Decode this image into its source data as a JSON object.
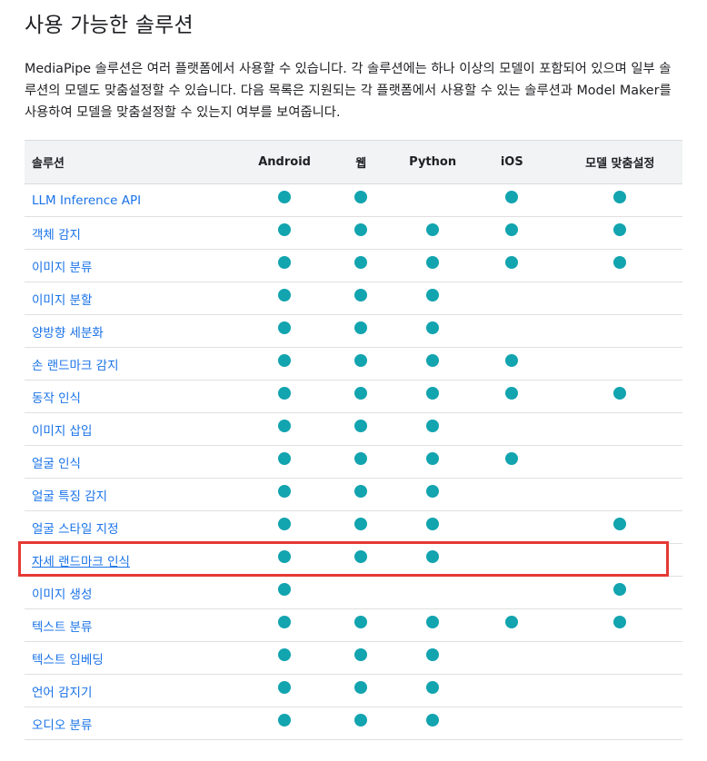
{
  "page": {
    "title": "사용 가능한 솔루션",
    "intro": "MediaPipe 솔루션은 여러 플랫폼에서 사용할 수 있습니다. 각 솔루션에는 하나 이상의 모델이 포함되어 있으며 일부 솔루션의 모델도 맞춤설정할 수 있습니다. 다음 목록은 지원되는 각 플랫폼에서 사용할 수 있는 솔루션과 Model Maker를 사용하여 모델을 맞춤설정할 수 있는지 여부를 보여줍니다."
  },
  "table": {
    "headers": [
      "솔루션",
      "Android",
      "웹",
      "Python",
      "iOS",
      "모델 맞춤설정"
    ],
    "rows": [
      {
        "name": "LLM Inference API",
        "android": true,
        "web": true,
        "python": false,
        "ios": true,
        "custom": true
      },
      {
        "name": "객체 감지",
        "android": true,
        "web": true,
        "python": true,
        "ios": true,
        "custom": true
      },
      {
        "name": "이미지 분류",
        "android": true,
        "web": true,
        "python": true,
        "ios": true,
        "custom": true
      },
      {
        "name": "이미지 분할",
        "android": true,
        "web": true,
        "python": true,
        "ios": false,
        "custom": false
      },
      {
        "name": "양방향 세분화",
        "android": true,
        "web": true,
        "python": true,
        "ios": false,
        "custom": false
      },
      {
        "name": "손 랜드마크 감지",
        "android": true,
        "web": true,
        "python": true,
        "ios": true,
        "custom": false
      },
      {
        "name": "동작 인식",
        "android": true,
        "web": true,
        "python": true,
        "ios": true,
        "custom": true
      },
      {
        "name": "이미지 삽입",
        "android": true,
        "web": true,
        "python": true,
        "ios": false,
        "custom": false
      },
      {
        "name": "얼굴 인식",
        "android": true,
        "web": true,
        "python": true,
        "ios": true,
        "custom": false
      },
      {
        "name": "얼굴 특징 감지",
        "android": true,
        "web": true,
        "python": true,
        "ios": false,
        "custom": false
      },
      {
        "name": "얼굴 스타일 지정",
        "android": true,
        "web": true,
        "python": true,
        "ios": false,
        "custom": true
      },
      {
        "name": "자세 랜드마크 인식",
        "android": true,
        "web": true,
        "python": true,
        "ios": false,
        "custom": false,
        "highlighted": true
      },
      {
        "name": "이미지 생성",
        "android": true,
        "web": false,
        "python": false,
        "ios": false,
        "custom": true
      },
      {
        "name": "텍스트 분류",
        "android": true,
        "web": true,
        "python": true,
        "ios": true,
        "custom": true
      },
      {
        "name": "텍스트 임베딩",
        "android": true,
        "web": true,
        "python": true,
        "ios": false,
        "custom": false
      },
      {
        "name": "언어 감지기",
        "android": true,
        "web": true,
        "python": true,
        "ios": false,
        "custom": false
      },
      {
        "name": "오디오 분류",
        "android": true,
        "web": true,
        "python": true,
        "ios": false,
        "custom": false
      }
    ]
  },
  "colors": {
    "link": "#1a73e8",
    "dot": "#12a4af",
    "header_bg": "#f1f3f4",
    "highlight_border": "#e53935"
  },
  "icons": {
    "supported": "supported-dot-icon"
  }
}
